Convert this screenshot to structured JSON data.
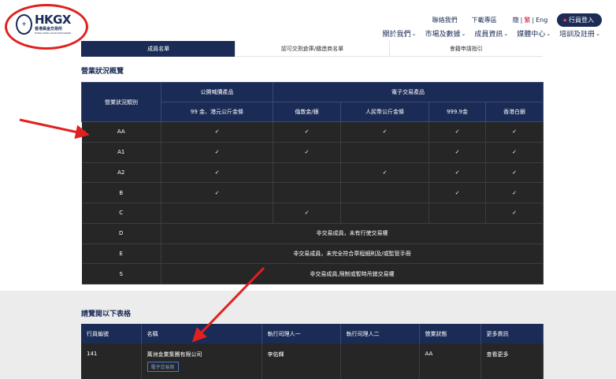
{
  "header": {
    "logo": {
      "main": "HKGX",
      "sub": "香港黃金交易所",
      "sub_en": "HONG KONG GOLD EXCHANGE"
    },
    "top_links": [
      "聯絡我們",
      "下載專區"
    ],
    "lang": [
      "簡",
      "繁",
      "Eng"
    ],
    "login": "行員登入",
    "nav": [
      "關於我們",
      "市場及數據",
      "成員資訊",
      "媒體中心",
      "培訓及註冊"
    ]
  },
  "tabs": [
    "成員名單",
    "認可交割倉庫/鑄造商名單",
    "會籍申請指引"
  ],
  "status_section": {
    "title": "營業狀況概覽",
    "row_header": "營業狀況類別",
    "group1": "公開喊價產品",
    "group2": "電子交易產品",
    "columns": [
      "99 金、港元公斤金條",
      "倫敦金/銀",
      "人民幣公斤金條",
      "999.9金",
      "香港白銀"
    ],
    "check": "✓",
    "rows": [
      {
        "cat": "AA",
        "marks": [
          true,
          true,
          true,
          true,
          true
        ]
      },
      {
        "cat": "A1",
        "marks": [
          true,
          true,
          false,
          true,
          true
        ]
      },
      {
        "cat": "A2",
        "marks": [
          true,
          false,
          true,
          true,
          true
        ]
      },
      {
        "cat": "B",
        "marks": [
          true,
          false,
          false,
          true,
          true
        ]
      },
      {
        "cat": "C",
        "marks": [
          false,
          true,
          false,
          false,
          true
        ]
      }
    ],
    "notes": [
      {
        "cat": "D",
        "text": "非交易成員，未有行使交易權"
      },
      {
        "cat": "E",
        "text": "非交易成員，未完全符合章程細則及/或監管手冊"
      },
      {
        "cat": "S",
        "text": "非交易成員,限制或暫時吊銷交易權"
      }
    ]
  },
  "member_section": {
    "title": "請覽閱以下表格",
    "headers": [
      "行員編號",
      "名稱",
      "執行司理人一",
      "執行司理人二",
      "營業狀態",
      "更多資訊"
    ],
    "row": {
      "id": "141",
      "name": "萬洲金業集團有限公司",
      "tag": "電子交易商",
      "manager1": "李佑輝",
      "manager2": "",
      "status": "AA",
      "more": "查看更多"
    }
  }
}
